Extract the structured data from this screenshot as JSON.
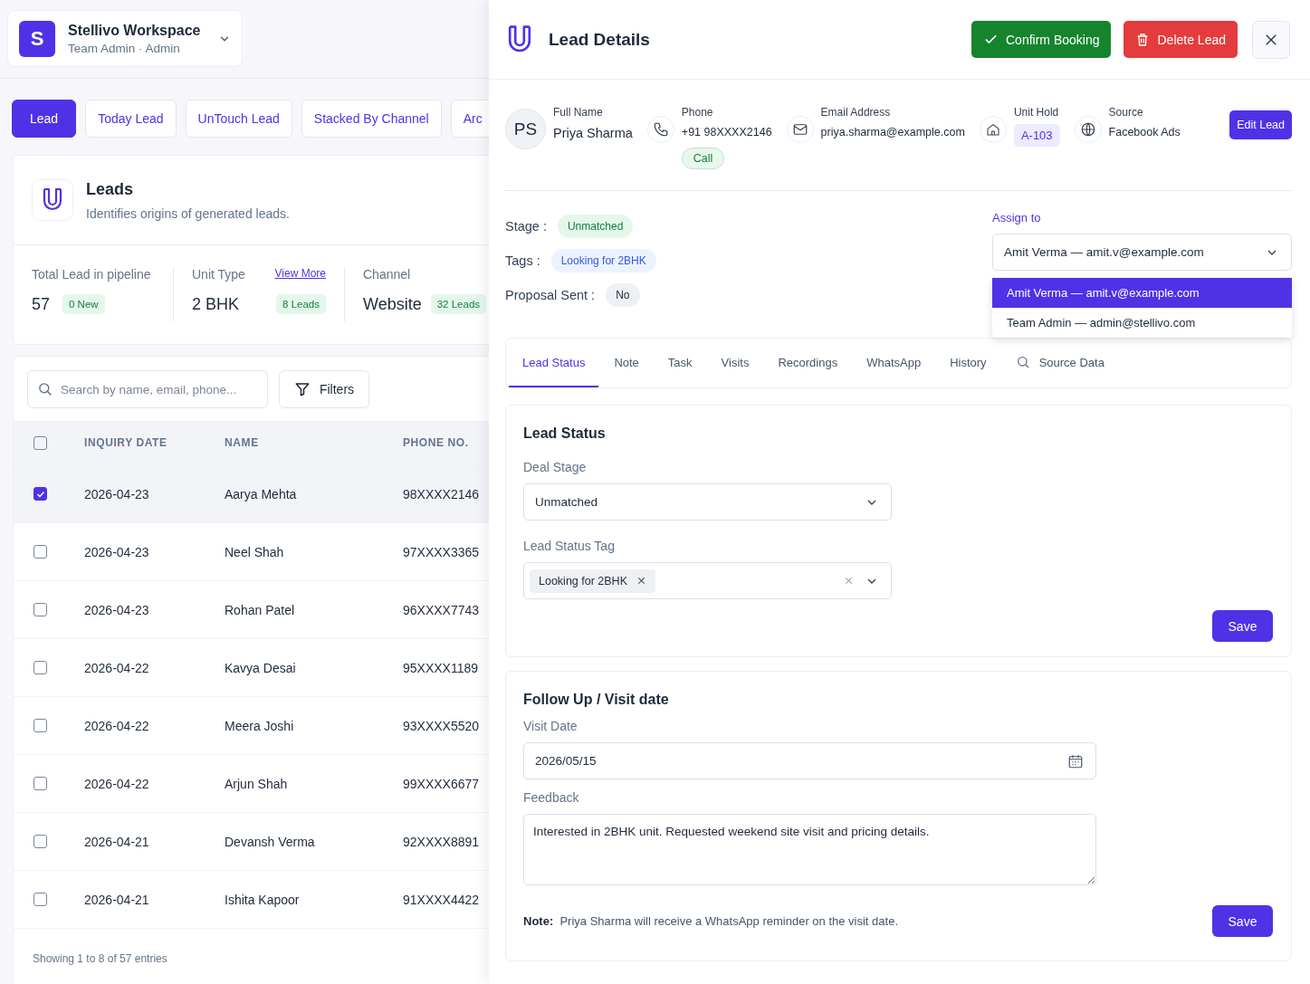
{
  "workspace": {
    "initial": "S",
    "name": "Stellivo Workspace",
    "role": "Team Admin · Admin"
  },
  "view_tabs": [
    {
      "label": "Lead",
      "selected": true
    },
    {
      "label": "Today Lead",
      "selected": false
    },
    {
      "label": "UnTouch Lead",
      "selected": false
    },
    {
      "label": "Stacked By Channel",
      "selected": false
    },
    {
      "label": "Arc",
      "selected": false
    }
  ],
  "leads_card": {
    "title": "Leads",
    "subtitle": "Identifies origins of generated leads.",
    "stats": [
      {
        "label": "Total Lead in pipeline",
        "value": "57",
        "badge": "0 New"
      },
      {
        "label": "Unit Type",
        "link": "View More",
        "value": "2 BHK",
        "badge": "8 Leads"
      },
      {
        "label": "Channel",
        "value": "Website",
        "badge": "32 Leads"
      }
    ]
  },
  "table": {
    "search_placeholder": "Search by name, email, phone...",
    "filters_label": "Filters",
    "header_checked": false,
    "columns": [
      "INQUIRY DATE",
      "NAME",
      "PHONE NO."
    ],
    "rows": [
      {
        "checked": true,
        "date": "2026-04-23",
        "name": "Aarya Mehta",
        "phone": "98XXXX2146"
      },
      {
        "checked": false,
        "date": "2026-04-23",
        "name": "Neel Shah",
        "phone": "97XXXX3365"
      },
      {
        "checked": false,
        "date": "2026-04-23",
        "name": "Rohan Patel",
        "phone": "96XXXX7743"
      },
      {
        "checked": false,
        "date": "2026-04-22",
        "name": "Kavya Desai",
        "phone": "95XXXX1189"
      },
      {
        "checked": false,
        "date": "2026-04-22",
        "name": "Meera Joshi",
        "phone": "93XXXX5520"
      },
      {
        "checked": false,
        "date": "2026-04-22",
        "name": "Arjun Shah",
        "phone": "99XXXX6677"
      },
      {
        "checked": false,
        "date": "2026-04-21",
        "name": "Devansh Verma",
        "phone": "92XXXX8891"
      },
      {
        "checked": false,
        "date": "2026-04-21",
        "name": "Ishita Kapoor",
        "phone": "91XXXX4422"
      }
    ],
    "footer": "Showing 1 to 8 of 57 entries"
  },
  "drawer": {
    "title": "Lead Details",
    "confirm_button": "Confirm Booking",
    "delete_button": "Delete Lead",
    "profile": {
      "initials": "PS",
      "full_name_label": "Full Name",
      "full_name": "Priya Sharma",
      "phone_label": "Phone",
      "phone": "+91 98XXXX2146",
      "call_label": "Call",
      "email_label": "Email Address",
      "email": "priya.sharma@example.com",
      "unit_label": "Unit Hold",
      "unit": "A-103",
      "source_label": "Source",
      "source": "Facebook Ads",
      "edit_button": "Edit Lead"
    },
    "stage_label": "Stage :",
    "stage": "Unmatched",
    "tags_label": "Tags :",
    "tag": "Looking for 2BHK",
    "proposal_label": "Proposal Sent :",
    "proposal": "No",
    "assign": {
      "label": "Assign to",
      "value": "Amit Verma — amit.v@example.com",
      "options": [
        {
          "label": "Amit Verma — amit.v@example.com",
          "selected": true
        },
        {
          "label": "Team Admin — admin@stellivo.com",
          "selected": false
        }
      ]
    },
    "tabs": [
      {
        "label": "Lead Status",
        "selected": true,
        "kind": "plain"
      },
      {
        "label": "Note",
        "selected": false,
        "kind": "plain"
      },
      {
        "label": "Task",
        "selected": false,
        "kind": "plain"
      },
      {
        "label": "Visits",
        "selected": false,
        "kind": "plain"
      },
      {
        "label": "Recordings",
        "selected": false,
        "kind": "plain"
      },
      {
        "label": "WhatsApp",
        "selected": false,
        "kind": "plain"
      },
      {
        "label": "History",
        "selected": false,
        "kind": "plain"
      },
      {
        "label": "Source Data",
        "selected": false,
        "kind": "search"
      }
    ],
    "status_card": {
      "title": "Lead Status",
      "deal_stage_label": "Deal Stage",
      "deal_stage": "Unmatched",
      "tag_label": "Lead Status Tag",
      "tag_chip": "Looking for 2BHK",
      "save": "Save"
    },
    "followup_card": {
      "title": "Follow Up / Visit date",
      "visit_label": "Visit Date",
      "visit_date": "2026/05/15",
      "feedback_label": "Feedback",
      "feedback": "Interested in 2BHK unit. Requested weekend site visit and pricing details.",
      "note": "**Note:**  Priya Sharma will receive a WhatsApp reminder on the visit date.",
      "save": "Save"
    }
  }
}
